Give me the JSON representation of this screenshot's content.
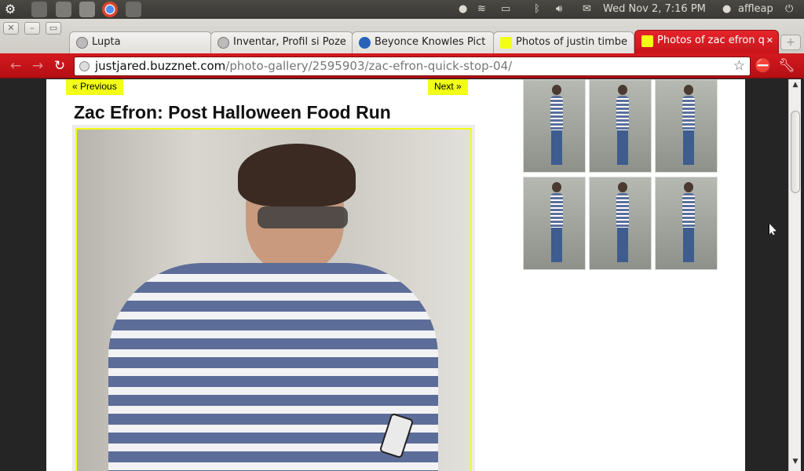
{
  "system_panel": {
    "datetime": "Wed Nov  2,  7:16 PM",
    "user": "affleap"
  },
  "tabs": [
    {
      "label": "Lupta",
      "favicon": "globe-icon"
    },
    {
      "label": "Inventar, Profil si Poze",
      "favicon": "globe-icon"
    },
    {
      "label": "Beyonce Knowles Pict",
      "favicon": "site-icon"
    },
    {
      "label": "Photos of justin timbe",
      "favicon": "j-icon"
    },
    {
      "label": "Photos of zac efron q",
      "favicon": "j-icon"
    }
  ],
  "address": {
    "host": "justjared.buzznet.com",
    "path": "/photo-gallery/2595903/zac-efron-quick-stop-04/"
  },
  "page": {
    "prev_label": "« Previous",
    "next_label": "Next »",
    "title": "Zac Efron: Post Halloween Food Run"
  },
  "colors": {
    "browser_accent": "#c8141b",
    "nav_highlight": "#f2ff16"
  },
  "thumbnails_count": 6
}
